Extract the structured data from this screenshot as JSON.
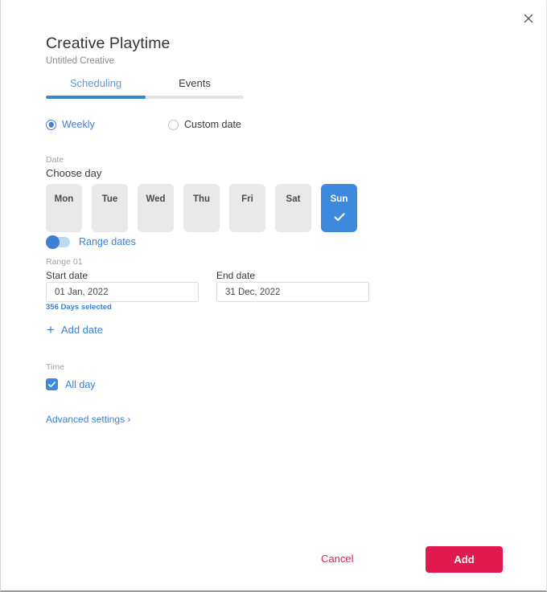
{
  "dialog": {
    "close_icon": "close-icon",
    "title": "Creative Playtime",
    "subtitle": "Untitled Creative"
  },
  "tabs": [
    {
      "label": "Scheduling",
      "active": true
    },
    {
      "label": "Events",
      "active": false
    }
  ],
  "mode_options": [
    {
      "label": "Weekly",
      "selected": true
    },
    {
      "label": "Custom date",
      "selected": false
    }
  ],
  "date_section": {
    "caption": "Date",
    "heading": "Choose day",
    "days": [
      {
        "label": "Mon",
        "selected": false
      },
      {
        "label": "Tue",
        "selected": false
      },
      {
        "label": "Wed",
        "selected": false
      },
      {
        "label": "Thu",
        "selected": false
      },
      {
        "label": "Fri",
        "selected": false
      },
      {
        "label": "Sat",
        "selected": false
      },
      {
        "label": "Sun",
        "selected": true
      }
    ],
    "range_toggle": {
      "label": "Range dates",
      "on": true
    },
    "range_caption": "Range 01",
    "start": {
      "label": "Start date",
      "value": "01 Jan, 2022",
      "placeholder": "Start date"
    },
    "end": {
      "label": "End date",
      "value": "31 Dec, 2022",
      "placeholder": "End date"
    },
    "days_selected": "356 Days selected",
    "add_date_label": "Add date",
    "add_date_icon": "plus-icon"
  },
  "time_section": {
    "caption": "Time",
    "all_day_label": "All day",
    "all_day_checked": true
  },
  "advanced_settings_label": "Advanced settings ›",
  "footer": {
    "cancel_label": "Cancel",
    "add_label": "Add"
  },
  "colors": {
    "accent_blue": "#3d7fd6",
    "chip_blue": "#3d89dd",
    "tab_indicator": "#3584cd",
    "primary_red": "#e01a4f",
    "cancel_red": "#df2052",
    "chip_grey": "#e9e9e9"
  }
}
